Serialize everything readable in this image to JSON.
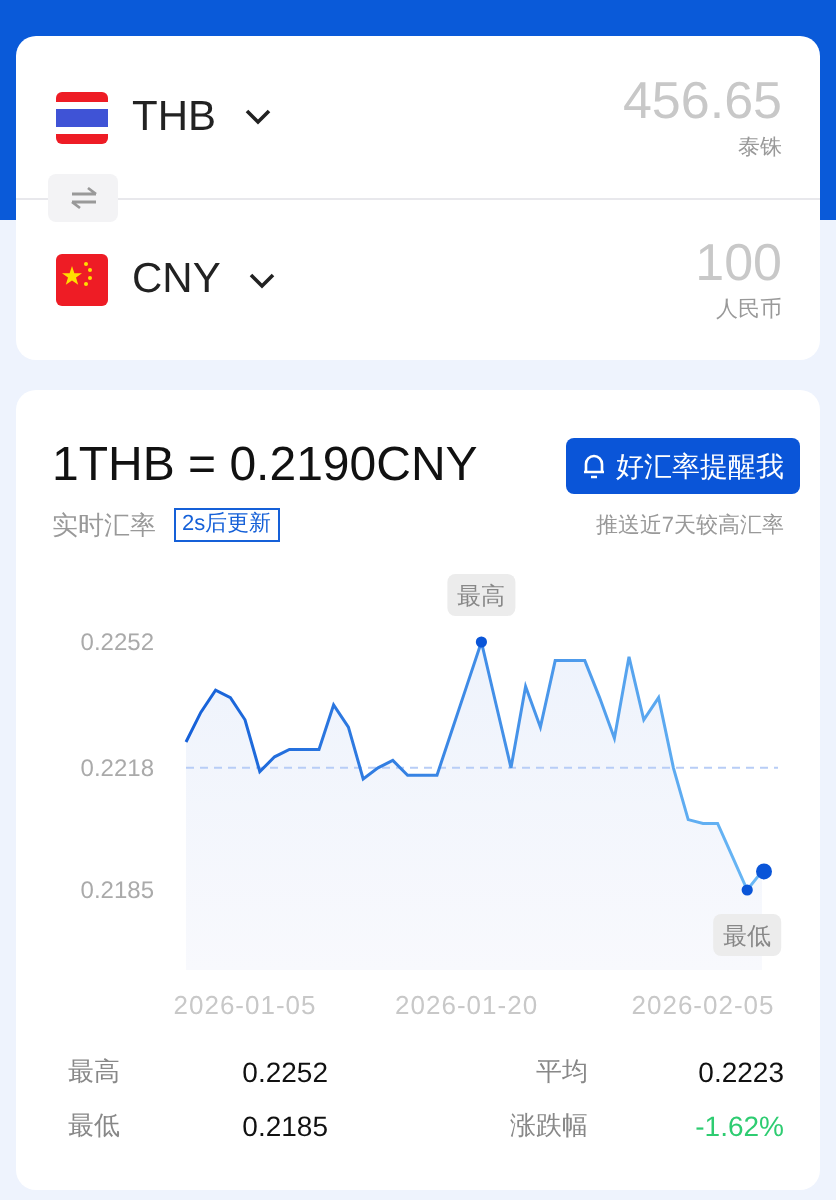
{
  "converter": {
    "rows": [
      {
        "kind": "thailand",
        "code": "THB",
        "amount": "456.65",
        "currency_name": "泰铢"
      },
      {
        "kind": "china",
        "code": "CNY",
        "amount": "100",
        "currency_name": "人民币"
      }
    ]
  },
  "rate": {
    "headline": "1THB = 0.2190CNY",
    "label": "实时汇率",
    "countdown": "2s后更新",
    "alert_button": "好汇率提醒我",
    "alert_hint": "推送近7天较高汇率"
  },
  "chart_data": {
    "type": "area",
    "categories": [
      null,
      null,
      null,
      null,
      "2026-01-05",
      null,
      null,
      null,
      null,
      null,
      null,
      null,
      null,
      null,
      null,
      null,
      null,
      null,
      null,
      "2026-01-20",
      null,
      null,
      null,
      null,
      null,
      null,
      null,
      null,
      null,
      null,
      null,
      null,
      null,
      null,
      null,
      "2026-02-05",
      null,
      null,
      null,
      null
    ],
    "series": [
      {
        "color": "#1560d8",
        "values": [
          0.2225,
          0.2233,
          0.2239,
          0.2237,
          0.2231,
          0.2217,
          0.2221,
          0.2223,
          0.2223,
          0.2223,
          0.2235,
          0.2229,
          0.2215,
          0.2218,
          0.222,
          0.2216,
          0.2216,
          0.2216,
          0.2228,
          0.224,
          0.2252,
          0.2235,
          0.2218,
          0.224,
          0.2229,
          0.2247,
          0.2247,
          0.2247,
          0.2237,
          0.2226,
          0.2248,
          0.2231,
          0.2237,
          0.2218,
          0.2204,
          0.2203,
          0.2203,
          0.2194,
          0.2185,
          0.219
        ]
      }
    ],
    "yticks": [
      {
        "value": 0.2252,
        "label": "0.2252"
      },
      {
        "value": 0.2218,
        "label": "0.2218"
      },
      {
        "value": 0.2185,
        "label": "0.2185"
      }
    ],
    "ylim": [
      0.2185,
      0.2252
    ],
    "ref_lines": [
      {
        "axis": "y",
        "value": 0.2218
      }
    ],
    "annotations": [
      {
        "text": "最高",
        "y": 0.2252
      },
      {
        "text": "最低",
        "y": 0.2185
      }
    ]
  },
  "stats": [
    {
      "label": "最高",
      "value": "0.2252",
      "color": "#111111"
    },
    {
      "label": "平均",
      "value": "0.2223",
      "color": "#111111"
    },
    {
      "label": "最低",
      "value": "0.2185",
      "color": "#111111"
    },
    {
      "label": "涨跌幅",
      "value": "-1.62%",
      "color": "#2ecc71"
    }
  ]
}
